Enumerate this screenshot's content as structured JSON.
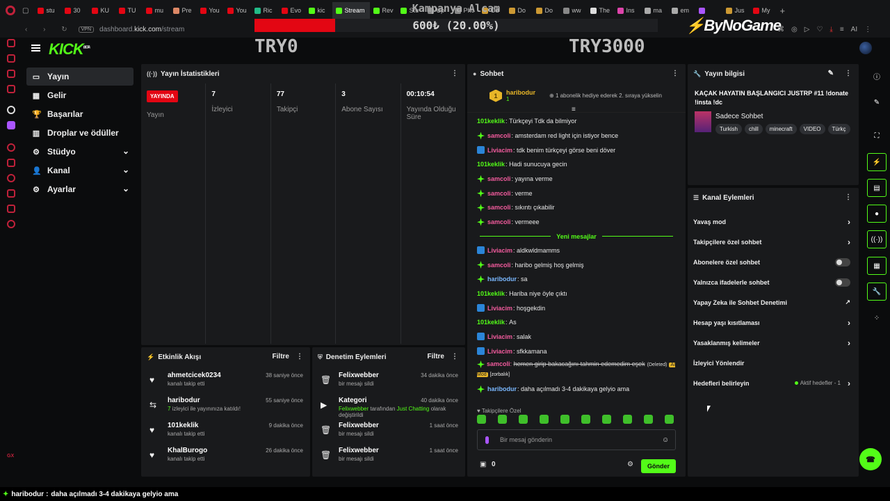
{
  "browser": {
    "tabs": [
      {
        "label": "stu",
        "color": "#e30613"
      },
      {
        "label": "30",
        "color": "#e30613"
      },
      {
        "label": "KU",
        "color": "#e30613"
      },
      {
        "label": "TU",
        "color": "#e30613"
      },
      {
        "label": "mu",
        "color": "#e30613"
      },
      {
        "label": "Pre",
        "color": "#d86"
      },
      {
        "label": "You",
        "color": "#e30613"
      },
      {
        "label": "You",
        "color": "#e30613"
      },
      {
        "label": "Ric",
        "color": "#2b8"
      },
      {
        "label": "Evo",
        "color": "#e30613"
      },
      {
        "label": "kic",
        "color": "#53fc18"
      },
      {
        "label": "Stream",
        "color": "#53fc18",
        "active": true
      },
      {
        "label": "Rev",
        "color": "#53fc18"
      },
      {
        "label": "Stu",
        "color": "#53fc18"
      },
      {
        "label": "Up",
        "color": "#888"
      },
      {
        "label": "Pho",
        "color": "#888"
      },
      {
        "label": "Öd",
        "color": "#c93"
      },
      {
        "label": "Do",
        "color": "#c93"
      },
      {
        "label": "Do",
        "color": "#c93"
      },
      {
        "label": "ww",
        "color": "#888"
      },
      {
        "label": "The",
        "color": "#ddd"
      },
      {
        "label": "Ins",
        "color": "#d4a"
      },
      {
        "label": "ma",
        "color": "#aaa"
      },
      {
        "label": "em",
        "color": "#aaa"
      },
      {
        "label": "",
        "color": "#a5f"
      },
      {
        "label": "Jus",
        "color": "#c93"
      },
      {
        "label": "My",
        "color": "#e30613"
      }
    ],
    "nav_glyphs": "‹ › ↻",
    "vpn": "VPN",
    "url_prefix": "dashboard.",
    "url_host": "kick.com",
    "url_path": "/stream",
    "right_ai": "AI"
  },
  "overlay": {
    "goal_title": "Kampanya Alcam",
    "goal_progress": "600₺ (20.00%)",
    "goal_fraction": 0.2,
    "goal_start": "TRY0",
    "goal_end": "TRY3000",
    "brand": "ByNoGame",
    "bottom_user": "haribodur",
    "bottom_sep": ":",
    "bottom_msg": "daha açılmadı 3-4 dakikaya gelyio ama"
  },
  "header": {
    "logo": "KICK",
    "logo_sup": "BETA"
  },
  "sidebar": {
    "items": [
      {
        "label": "Yayın",
        "icon": "▭",
        "active": true
      },
      {
        "label": "Gelir",
        "icon": "▦"
      },
      {
        "label": "Başarılar",
        "icon": "🏆"
      },
      {
        "label": "Droplar ve ödüller",
        "icon": "▥"
      },
      {
        "label": "Stüdyo",
        "icon": "⚙",
        "chevron": true
      },
      {
        "label": "Kanal",
        "icon": "👤",
        "chevron": true
      },
      {
        "label": "Ayarlar",
        "icon": "⚙",
        "chevron": true
      }
    ]
  },
  "stats": {
    "title": "Yayın İstatistikleri",
    "live_badge": "YAYINDA",
    "items": [
      {
        "value": "",
        "label": "Yayın"
      },
      {
        "value": "7",
        "label": "İzleyici"
      },
      {
        "value": "77",
        "label": "Takipçi"
      },
      {
        "value": "3",
        "label": "Abone Sayısı"
      },
      {
        "value": "00:10:54",
        "label": "Yayında Olduğu Süre"
      }
    ]
  },
  "activity": {
    "title": "Etkinlik Akışı",
    "filter": "Filtre",
    "rows": [
      {
        "name": "ahmetcicek0234",
        "desc": "kanalı takip etti",
        "time": "38 saniye önce",
        "icon": "♥"
      },
      {
        "name": "haribodur",
        "desc_g": "7",
        "desc": "izleyici ile yayınınıza katıldı!",
        "time": "55 saniye önce",
        "icon": "⇆"
      },
      {
        "name": "101keklik",
        "desc": "kanalı takip etti",
        "time": "9 dakika önce",
        "icon": "♥"
      },
      {
        "name": "KhalBurogo",
        "desc": "kanalı takip etti",
        "time": "26 dakika önce",
        "icon": "♥"
      }
    ]
  },
  "moderation": {
    "title": "Denetim Eylemleri",
    "filter": "Filtre",
    "rows": [
      {
        "name": "Felixwebber",
        "desc": "bir mesajı sildi",
        "time": "34 dakika önce",
        "icon": "🗑"
      },
      {
        "name": "Kategori",
        "desc_g": "Felixwebber",
        "desc_mid": "tarafından",
        "desc_g2": "Just Chatting",
        "desc": "olarak değiştirildi",
        "time": "40 dakika önce",
        "icon": "▶"
      },
      {
        "name": "Felixwebber",
        "desc": "bir mesajı sildi",
        "time": "1 saat önce",
        "icon": "🗑"
      },
      {
        "name": "Felixwebber",
        "desc": "bir mesajı sildi",
        "time": "1 saat önce",
        "icon": "🗑"
      }
    ]
  },
  "chat": {
    "title": "Sohbet",
    "pinned_user": "haribodur",
    "pinned_badge": "1",
    "pinned_sub": "1",
    "pinned_text": "1 abonelik hediye ederek 2. sıraya yükselin",
    "new_messages": "Yeni mesajlar",
    "messages_before": [
      {
        "user": "101keklik",
        "color": "green",
        "badge": "",
        "text": "Türkçeyi Tdk da bilmiyor"
      },
      {
        "user": "samcoli",
        "color": "pink",
        "badge": "star",
        "text": "amsterdam red light için istiyor bence"
      },
      {
        "user": "Liviacim",
        "color": "pink",
        "badge": "arrow",
        "text": "tdk benim türkçeyi görse beni döver"
      },
      {
        "user": "101keklik",
        "color": "green",
        "badge": "",
        "text": "Hadi sunucuya gecin"
      },
      {
        "user": "samcoli",
        "color": "pink",
        "badge": "star",
        "text": "yayına verme"
      },
      {
        "user": "samcoli",
        "color": "pink",
        "badge": "star",
        "text": "verme"
      },
      {
        "user": "samcoli",
        "color": "pink",
        "badge": "star",
        "text": "sıkıntı çıkabilir"
      },
      {
        "user": "samcoli",
        "color": "pink",
        "badge": "star",
        "text": "vermeee"
      }
    ],
    "messages_after": [
      {
        "user": "Liviacim",
        "color": "pink",
        "badge": "arrow",
        "text": "aldkwldmamms"
      },
      {
        "user": "samcoli",
        "color": "pink",
        "badge": "star",
        "text": "haribo gelmiş hoş gelmiş"
      },
      {
        "user": "haribodur",
        "color": "blue",
        "badge": "star",
        "text": "sa"
      },
      {
        "user": "101keklik",
        "color": "green",
        "badge": "",
        "text": "Hariba niye öyle çıktı"
      },
      {
        "user": "Liviacim",
        "color": "pink",
        "badge": "arrow",
        "text": "hoşgekdin"
      },
      {
        "user": "101keklik",
        "color": "green",
        "badge": "",
        "text": "As"
      },
      {
        "user": "Liviacim",
        "color": "pink",
        "badge": "arrow",
        "text": "salak"
      },
      {
        "user": "Liviacim",
        "color": "pink",
        "badge": "arrow",
        "text": "sfkkamana"
      }
    ],
    "deleted_msg": {
      "user": "samcoli",
      "text": "hemen girip bakacağını tahmin edemedim eşek",
      "deleted": "(Deleted)",
      "ai": "AI Mod",
      "reason": "[zorbalık]"
    },
    "last_msg": {
      "user": "haribodur",
      "text": "daha açılmadı 3-4 dakikaya gelyio ama"
    },
    "followers_only": "Takipçilere Özel",
    "input_placeholder": "Bir mesaj gönderin",
    "point_count": "0",
    "send": "Gönder"
  },
  "stream_info": {
    "title": "Yayın bilgisi",
    "stream_title": "KAÇAK HAYATIN BAŞLANGICI JUSTRP #11 !donate !insta !dc",
    "category": "Sadece Sohbet",
    "tags": [
      "Turkish",
      "chill",
      "minecraft",
      "VIDEO",
      "Türkç"
    ]
  },
  "channel_actions": {
    "title": "Kanal Eylemleri",
    "rows": [
      {
        "label": "Yavaş mod",
        "type": "chevron"
      },
      {
        "label": "Takipçilere özel sohbet",
        "type": "chevron"
      },
      {
        "label": "Abonelere özel sohbet",
        "type": "toggle"
      },
      {
        "label": "Yalnızca ifadelerle sohbet",
        "type": "toggle"
      },
      {
        "label": "Yapay Zeka ile Sohbet Denetimi",
        "type": "external"
      },
      {
        "label": "Hesap yaşı kısıtlaması",
        "type": "chevron"
      },
      {
        "label": "Yasaklanmış kelimeler",
        "type": "chevron"
      },
      {
        "label": "İzleyici Yönlendir",
        "type": "none"
      },
      {
        "label": "Hedefleri belirleyin",
        "type": "chevron",
        "extra": "Aktif hedefler - 1"
      }
    ]
  },
  "left_rail_bottom": "GX"
}
